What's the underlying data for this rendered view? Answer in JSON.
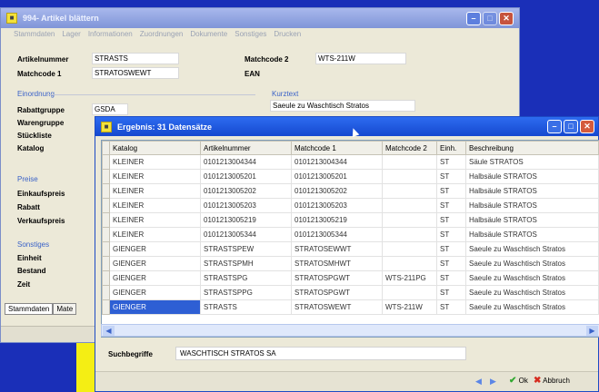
{
  "back_window": {
    "title": "994- Artikel blättern",
    "menu": [
      "Stammdaten",
      "Lager",
      "Informationen",
      "Zuordnungen",
      "Dokumente",
      "Sonstiges",
      "Drucken"
    ],
    "artikelnummer_label": "Artikelnummer",
    "artikelnummer_value": "STRASTS",
    "matchcode1_label": "Matchcode 1",
    "matchcode1_value": "STRATOSWEWT",
    "matchcode2_label": "Matchcode 2",
    "matchcode2_value": "WTS-211W",
    "ean_label": "EAN",
    "group_einordnung": "Einordnung",
    "group_kurztext": "Kurztext",
    "kurztext_value": "Saeule zu Waschtisch Stratos",
    "rabattgruppe_label": "Rabattgruppe",
    "rabattgruppe_value": "GSDA",
    "warengruppe_label": "Warengruppe",
    "stueckliste_label": "Stückliste",
    "katalog_label": "Katalog",
    "group_preise": "Preise",
    "einkaufspreis_label": "Einkaufspreis",
    "rabatt_label": "Rabatt",
    "verkaufspreis_label": "Verkaufspreis",
    "group_sonstiges": "Sonstiges",
    "einheit_label": "Einheit",
    "bestand_label": "Bestand",
    "zeit_label": "Zeit",
    "tab_stammdaten": "Stammdaten",
    "tab_mate": "Mate"
  },
  "front_window": {
    "title": "Ergebnis: 31 Datensätze",
    "columns": [
      "Katalog",
      "Artikelnummer",
      "Matchcode 1",
      "Matchcode 2",
      "Einh.",
      "Beschreibung"
    ],
    "rows": [
      [
        "KLEINER",
        "0101213004344",
        "0101213004344",
        "",
        "ST",
        "Säule STRATOS"
      ],
      [
        "KLEINER",
        "0101213005201",
        "0101213005201",
        "",
        "ST",
        "Halbsäule STRATOS"
      ],
      [
        "KLEINER",
        "0101213005202",
        "0101213005202",
        "",
        "ST",
        "Halbsäule STRATOS"
      ],
      [
        "KLEINER",
        "0101213005203",
        "0101213005203",
        "",
        "ST",
        "Halbsäule STRATOS"
      ],
      [
        "KLEINER",
        "0101213005219",
        "0101213005219",
        "",
        "ST",
        "Halbsäule STRATOS"
      ],
      [
        "KLEINER",
        "0101213005344",
        "0101213005344",
        "",
        "ST",
        "Halbsäule STRATOS"
      ],
      [
        "GIENGER",
        "STRASTSPEW",
        "STRATOSEWWT",
        "",
        "ST",
        "Saeule zu Waschtisch Stratos"
      ],
      [
        "GIENGER",
        "STRASTSPMH",
        "STRATOSMHWT",
        "",
        "ST",
        "Saeule zu Waschtisch Stratos"
      ],
      [
        "GIENGER",
        "STRASTSPG",
        "STRATOSPGWT",
        "WTS-211PG",
        "ST",
        "Saeule zu Waschtisch Stratos"
      ],
      [
        "GIENGER",
        "STRASTSPPG",
        "STRATOSPGWT",
        "",
        "ST",
        "Saeule zu Waschtisch Stratos"
      ],
      [
        "GIENGER",
        "STRASTS",
        "STRATOSWEWT",
        "WTS-211W",
        "ST",
        "Saeule zu Waschtisch Stratos"
      ]
    ],
    "selected_row": 10,
    "suchbegriffe_label": "Suchbegriffe",
    "suchbegriffe_value": "WASCHTISCH STRATOS SA",
    "ok_label": "Ok",
    "cancel_label": "Abbruch"
  }
}
